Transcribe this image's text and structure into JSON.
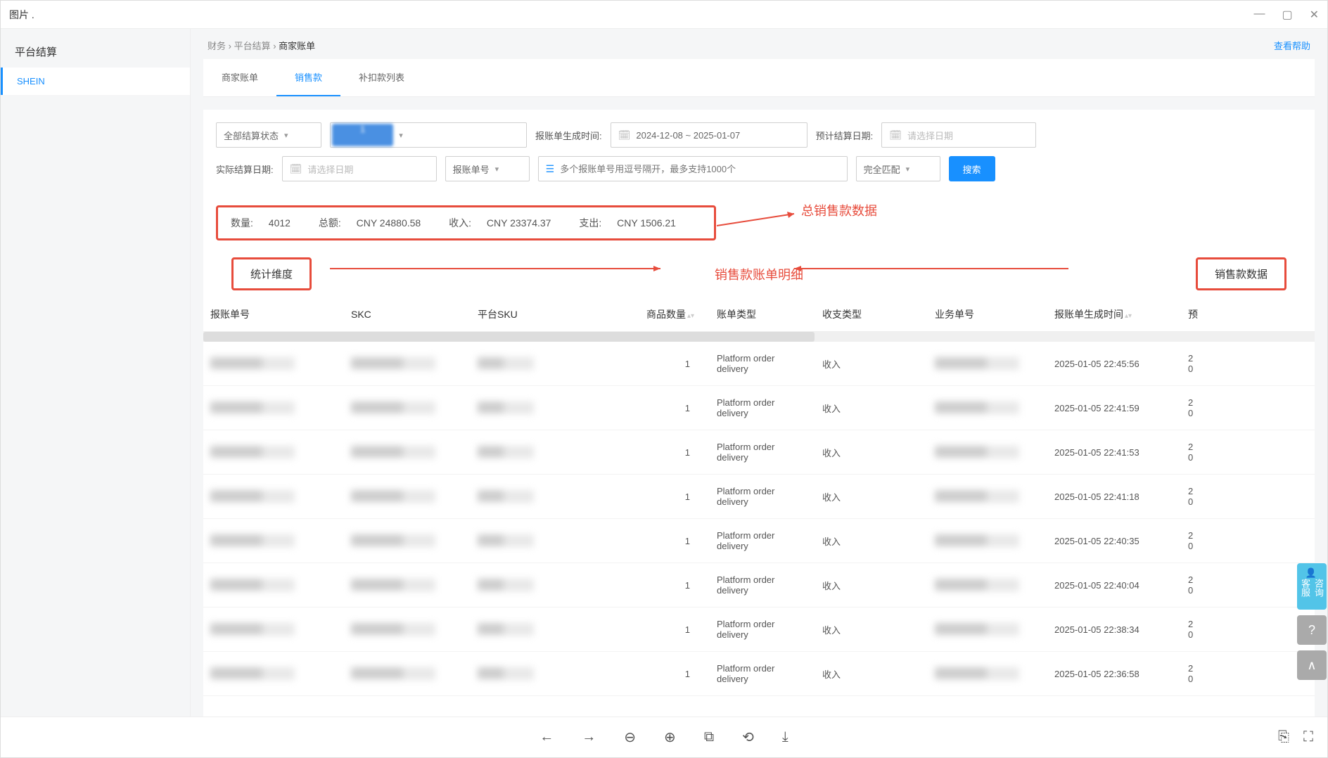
{
  "window": {
    "title": "图片 ."
  },
  "sidebar": {
    "title": "平台结算",
    "items": [
      {
        "label": "SHEIN"
      }
    ]
  },
  "breadcrumb": {
    "p1": "财务",
    "p2": "平台结算",
    "p3": "商家账单"
  },
  "help_link": "查看帮助",
  "tabs": [
    {
      "label": "商家账单"
    },
    {
      "label": "销售款",
      "active": true
    },
    {
      "label": "补扣款列表"
    }
  ],
  "filters": {
    "status_label": "全部结算状态",
    "range_shown": "1",
    "gen_label": "报账单生成时间:",
    "gen_value": "2024-12-08 ~ 2025-01-07",
    "est_label": "预计结算日期:",
    "est_placeholder": "请选择日期",
    "actual_label": "实际结算日期:",
    "actual_placeholder": "请选择日期",
    "billno_label": "报账单号",
    "billno_placeholder": "多个报账单号用逗号隔开，最多支持1000个",
    "match_label": "完全匹配",
    "search_btn": "搜索"
  },
  "summary": {
    "qty_label": "数量:",
    "qty_value": "4012",
    "total_label": "总额:",
    "total_value": "CNY 24880.58",
    "income_label": "收入:",
    "income_value": "CNY 23374.37",
    "expense_label": "支出:",
    "expense_value": "CNY 1506.21"
  },
  "annotations": {
    "summary": "总销售款数据",
    "stat_dim": "统计维度",
    "center": "销售款账单明细",
    "sales_data": "销售款数据"
  },
  "table": {
    "headers": [
      "报账单号",
      "SKC",
      "平台SKU",
      "商品数量",
      "账单类型",
      "收支类型",
      "业务单号",
      "报账单生成时间",
      "预"
    ],
    "rows": [
      {
        "qty": "1",
        "bill_type": "Platform order delivery",
        "io": "收入",
        "time": "2025-01-05 22:45:56",
        "extra": "2\n0"
      },
      {
        "qty": "1",
        "bill_type": "Platform order delivery",
        "io": "收入",
        "time": "2025-01-05 22:41:59",
        "extra": "2\n0"
      },
      {
        "qty": "1",
        "bill_type": "Platform order delivery",
        "io": "收入",
        "time": "2025-01-05 22:41:53",
        "extra": "2\n0"
      },
      {
        "qty": "1",
        "bill_type": "Platform order delivery",
        "io": "收入",
        "time": "2025-01-05 22:41:18",
        "extra": "2\n0"
      },
      {
        "qty": "1",
        "bill_type": "Platform order delivery",
        "io": "收入",
        "time": "2025-01-05 22:40:35",
        "extra": "2\n0"
      },
      {
        "qty": "1",
        "bill_type": "Platform order delivery",
        "io": "收入",
        "time": "2025-01-05 22:40:04",
        "extra": "2\n0"
      },
      {
        "qty": "1",
        "bill_type": "Platform order delivery",
        "io": "收入",
        "time": "2025-01-05 22:38:34",
        "extra": "2\n0"
      },
      {
        "qty": "1",
        "bill_type": "Platform order delivery",
        "io": "收入",
        "time": "2025-01-05 22:36:58",
        "extra": "2\n0"
      }
    ]
  },
  "float": {
    "support": "咨询客服"
  }
}
